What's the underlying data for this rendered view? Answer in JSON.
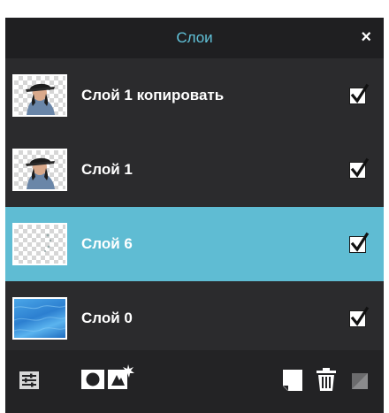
{
  "panel": {
    "title": "Слои",
    "close_glyph": "×"
  },
  "layers": [
    {
      "name": "Слой 1 копировать",
      "thumbnail": "portrait-transparent",
      "visible": true,
      "selected": false
    },
    {
      "name": "Слой 1",
      "thumbnail": "portrait-transparent",
      "visible": true,
      "selected": false
    },
    {
      "name": "Слой 6",
      "thumbnail": "transparent-sparse",
      "visible": true,
      "selected": true
    },
    {
      "name": "Слой 0",
      "thumbnail": "blue-water",
      "visible": true,
      "selected": false
    }
  ],
  "footer": {
    "icons": [
      "layer-settings-icon",
      "add-mask-icon",
      "add-fx-icon",
      "new-layer-icon",
      "delete-layer-icon",
      "merge-layer-icon"
    ]
  },
  "colors": {
    "accent": "#5fbcd3",
    "title": "#61c2d9",
    "panel_bg": "#2b2b2d",
    "header_bg": "#1f1f21"
  }
}
